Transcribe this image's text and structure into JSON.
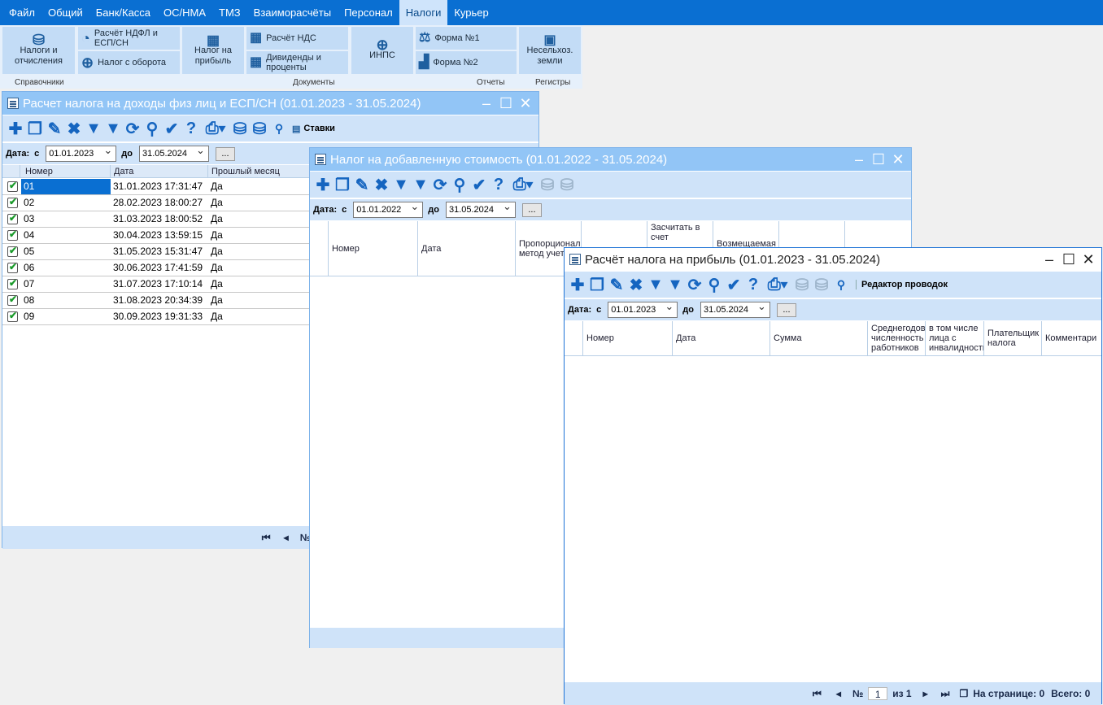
{
  "menu": [
    "Файл",
    "Общий",
    "Банк/Касса",
    "ОС/НМА",
    "ТМЗ",
    "Взаиморасчёты",
    "Персонал",
    "Налоги",
    "Курьер"
  ],
  "menu_active": "Налоги",
  "ribbon": {
    "taxes_label": "Налоги и отчисления",
    "ndfl_label": "Расчёт НДФЛ и ЕСП/СН",
    "turnover_label": "Налог с оборота",
    "profit_label": "Налог на прибыль",
    "vat_label": "Расчёт НДС",
    "dividends_label": "Дивиденды и проценты",
    "inps_label": "ИНПС",
    "form1_label": "Форма №1",
    "form2_label": "Форма №2",
    "land_label": "Несельхоз. земли",
    "group_refs": "Справочники",
    "group_docs": "Документы",
    "group_reports": "Отчеты",
    "group_registers": "Регистры"
  },
  "win1": {
    "title": "Расчет налога на доходы физ лиц и ЕСП/СН (01.01.2023 - 31.05.2024)",
    "rates_label": "Ставки",
    "date_label": "Дата:",
    "from_label": "с",
    "to_label": "до",
    "date_from": "01.01.2023",
    "date_to": "31.05.2024",
    "dots": "...",
    "columns": [
      "Номер",
      "Дата",
      "Прошлый месяц"
    ],
    "rows": [
      {
        "num": "01",
        "date": "31.01.2023 17:31:47",
        "prev": "Да"
      },
      {
        "num": "02",
        "date": "28.02.2023 18:00:27",
        "prev": "Да"
      },
      {
        "num": "03",
        "date": "31.03.2023 18:00:52",
        "prev": "Да"
      },
      {
        "num": "04",
        "date": "30.04.2023 13:59:15",
        "prev": "Да"
      },
      {
        "num": "05",
        "date": "31.05.2023 15:31:47",
        "prev": "Да"
      },
      {
        "num": "06",
        "date": "30.06.2023 17:41:59",
        "prev": "Да"
      },
      {
        "num": "07",
        "date": "31.07.2023 17:10:14",
        "prev": "Да"
      },
      {
        "num": "08",
        "date": "31.08.2023 20:34:39",
        "prev": "Да"
      },
      {
        "num": "09",
        "date": "30.09.2023 19:31:33",
        "prev": "Да"
      }
    ],
    "pager_no": "№"
  },
  "win2": {
    "title": "Налог на добавленную стоимость (01.01.2022 - 31.05.2024)",
    "date_label": "Дата:",
    "from_label": "с",
    "to_label": "до",
    "date_from": "01.01.2022",
    "date_to": "31.05.2024",
    "dots": "...",
    "columns": [
      "Номер",
      "Дата",
      "Пропорциональный метод учета",
      "Засчитать в счет",
      "Возмещаемая"
    ]
  },
  "win3": {
    "title": "Расчёт налога на прибыль (01.01.2023 - 31.05.2024)",
    "editor_label": "Редактор проводок",
    "date_label": "Дата:",
    "from_label": "с",
    "to_label": "до",
    "date_from": "01.01.2023",
    "date_to": "31.05.2024",
    "dots": "...",
    "columns": [
      "Номер",
      "Дата",
      "Сумма",
      "Среднегодовая численность работников",
      "в том числе лица с инвалидностью",
      "Плательщик налога",
      "Комментари"
    ],
    "pager_no": "№",
    "page": "1",
    "of_label": "из 1",
    "per_page": "На странице: 0",
    "total": "Всего: 0"
  }
}
